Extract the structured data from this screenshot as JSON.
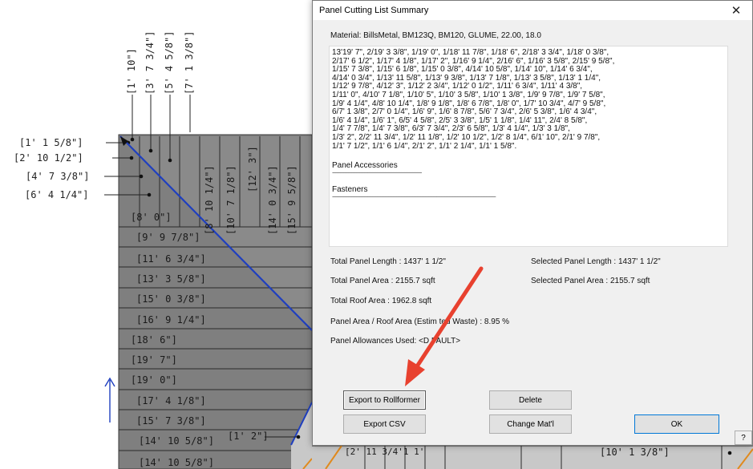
{
  "background": {
    "left_dims": [
      "[1' 1 5/8\"]",
      "[2' 10 1/2\"]",
      "[4' 7 3/8\"]",
      "[6' 4 1/4\"]"
    ],
    "top_dims": [
      "[1' 10\"]",
      "[3' 7 3/4\"]",
      "[5' 4 5/8\"]",
      "[7' 1 3/8\"]"
    ],
    "panel_dims": [
      "[8' 0\"]",
      "[9' 9 7/8\"]",
      "[11' 6 3/4\"]",
      "[13' 3 5/8\"]",
      "[15' 0 3/8\"]",
      "[16' 9 1/4\"]",
      "[18' 6\"]",
      "[19' 7\"]",
      "[19' 0\"]",
      "[17' 4 1/8\"]",
      "[15' 7 3/8\"]",
      "[14' 10 5/8\"]",
      "[14' 10 5/8\"]"
    ],
    "vertical_dims": [
      "[8' 10 1/4\"]",
      "[10' 7 1/8\"]",
      "[12' 3\"]",
      "[14' 0 3/4\"]",
      "[15' 9 5/8\"]"
    ],
    "bottom_dims": [
      "[1' 2\"]",
      "[2' 11 3/4'1 1'",
      "[10' 1 3/8\"]"
    ],
    "colors": {
      "panel_fill": "#7f7f7f",
      "diagonal": "#1f3fbf",
      "grid": "#2a2a2a",
      "arrow": "#e8412f"
    }
  },
  "dialog": {
    "title": "Panel Cutting List Summary",
    "close_label": "✕",
    "material": "Material: BillsMetal, BM123Q, BM120, GLUME, 22.00, 18.0",
    "cut_list": "13'19' 7\", 2/19' 3 3/8\", 1/19' 0\", 1/18' 11 7/8\", 1/18' 6\", 2/18' 3 3/4\", 1/18' 0 3/8\",\n2/17' 6 1/2\", 1/17' 4 1/8\", 1/17' 2\", 1/16' 9 1/4\", 2/16' 6\", 1/16' 3 5/8\", 2/15' 9 5/8\",\n1/15' 7 3/8\", 1/15' 6 1/8\", 1/15' 0 3/8\", 4/14' 10 5/8\", 1/14' 10\", 1/14' 6 3/4\",\n4/14' 0 3/4\", 1/13' 11 5/8\", 1/13' 9 3/8\", 1/13' 7 1/8\", 1/13' 3 5/8\", 1/13' 1 1/4\",\n1/12' 9 7/8\", 4/12' 3\", 1/12' 2 3/4\", 1/12' 0 1/2\", 1/11' 6 3/4\", 1/11' 4 3/8\",\n1/11' 0\", 4/10' 7 1/8\", 1/10' 5\", 1/10' 3 5/8\", 1/10' 1 3/8\", 1/9' 9 7/8\", 1/9' 7 5/8\",\n1/9' 4 1/4\", 4/8' 10 1/4\", 1/8' 9 1/8\", 1/8' 6 7/8\", 1/8' 0\", 1/7' 10 3/4\", 4/7' 9 5/8\",\n6/7' 1 3/8\", 2/7' 0 1/4\", 1/6' 9\", 1/6' 8 7/8\", 5/6' 7 3/4\", 2/6' 5 3/8\", 1/6' 4 3/4\",\n1/6' 4 1/4\", 1/6' 1\", 6/5' 4 5/8\", 2/5' 3 3/8\", 1/5' 1 1/8\", 1/4' 11\", 2/4' 8 5/8\",\n1/4' 7 7/8\", 1/4' 7 3/8\", 6/3' 7 3/4\", 2/3' 6 5/8\", 1/3' 4 1/4\", 1/3' 3 1/8\",\n1/3' 2\", 2/2' 11 3/4\", 1/2' 11 1/8\", 1/2' 10 1/2\", 1/2' 8 1/4\", 6/1' 10\", 2/1' 9 7/8\",\n1/1' 7 1/2\", 1/1' 6 1/4\", 2/1' 2\", 1/1' 2 1/4\", 1/1' 1 5/8\".",
    "panel_accessories": "Panel Accessories",
    "fasteners": "Fasteners",
    "rule_short": "------------------------------------------------------------",
    "rule_long": "------------------------------------------------------------------------------------------------------",
    "total_panel_length": "Total Panel Length : 1437' 1 1/2\"",
    "selected_panel_length": "Selected Panel Length : 1437' 1 1/2\"",
    "total_panel_area": "Total Panel Area : 2155.7 sqft",
    "selected_panel_area": "Selected Panel Area : 2155.7 sqft",
    "total_roof_area": "Total Roof Area : 1962.8 sqft",
    "waste": "Panel Area / Roof Area (Estim   ted Waste) : 8.95 %",
    "allowances": "Panel Allowances Used: <D  FAULT>",
    "buttons": {
      "export_rollformer": "Export to Rollformer",
      "delete": "Delete",
      "export_csv": "Export CSV",
      "change_mat": "Change Mat'l",
      "ok": "OK",
      "help": "?"
    }
  }
}
